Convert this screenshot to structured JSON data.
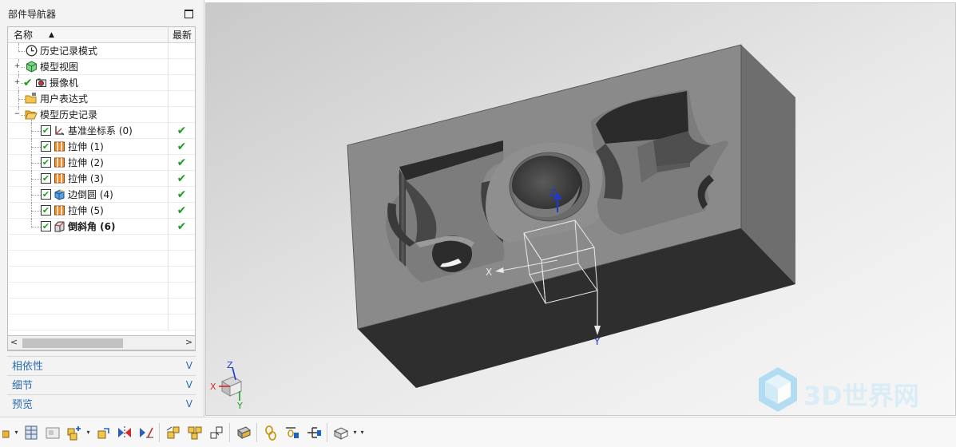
{
  "navigator": {
    "title": "部件导航器",
    "columns": {
      "name": "名称",
      "latest": "最新"
    },
    "items": [
      {
        "label": "历史记录模式",
        "icon": "clock-icon"
      },
      {
        "label": "模型视图",
        "icon": "model-view-icon"
      },
      {
        "label": "摄像机",
        "icon": "camera-icon"
      },
      {
        "label": "用户表达式",
        "icon": "folder-expression-icon"
      },
      {
        "label": "模型历史记录",
        "icon": "folder-open-icon"
      },
      {
        "label": "基准坐标系 (0)",
        "icon": "datum-csys-icon",
        "status": "✔"
      },
      {
        "label": "拉伸 (1)",
        "icon": "extrude-icon",
        "status": "✔"
      },
      {
        "label": "拉伸 (2)",
        "icon": "extrude-icon",
        "status": "✔"
      },
      {
        "label": "拉伸 (3)",
        "icon": "extrude-icon",
        "status": "✔"
      },
      {
        "label": "边倒圆 (4)",
        "icon": "edge-blend-icon",
        "status": "✔"
      },
      {
        "label": "拉伸 (5)",
        "icon": "extrude-icon",
        "status": "✔"
      },
      {
        "label": "倒斜角 (6)",
        "icon": "chamfer-icon",
        "status": "✔"
      }
    ],
    "sections": [
      {
        "label": "相依性"
      },
      {
        "label": "细节"
      },
      {
        "label": "预览"
      }
    ],
    "chevron": "V"
  },
  "viewport": {
    "axes": {
      "x": "X",
      "y": "Y",
      "z": "Z"
    },
    "watermark": "3D世界网"
  },
  "colors": {
    "check_green": "#18a018",
    "section_blue": "#2b6cb0"
  }
}
